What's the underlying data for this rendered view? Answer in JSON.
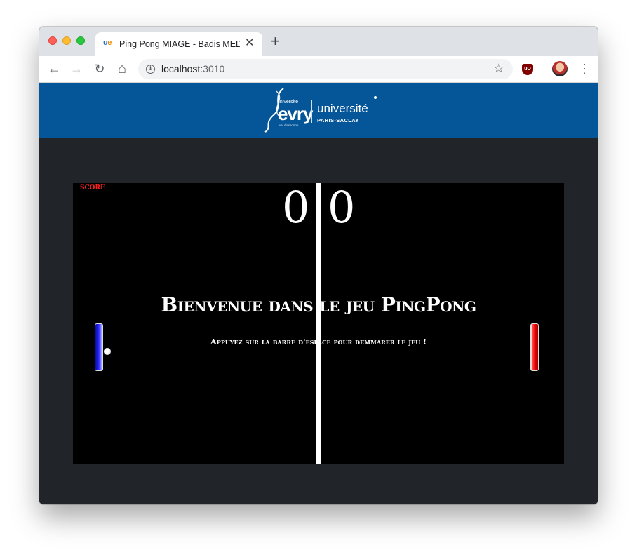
{
  "browser": {
    "tab": {
      "favicon_u": "u",
      "favicon_e": "e",
      "title": "Ping Pong MIAGE - Badis MEDDOUR",
      "close": "✕"
    },
    "new_tab": "+",
    "nav": {
      "back": "←",
      "forward": "→",
      "reload": "↻",
      "home": "⌂"
    },
    "url_host": "localhost:",
    "url_port": "3010",
    "bookmark": "☆",
    "extension": "uO",
    "menu": "⋮"
  },
  "header": {
    "logo_evry_small": "université",
    "logo_evry": "evry",
    "logo_evry_sub": "val d'essonne",
    "logo_univ": "université",
    "logo_paris": "PARIS-SACLAY",
    "background": "#055699"
  },
  "game": {
    "score_label": "SCORE",
    "score_left": "0",
    "score_right": "0",
    "welcome": "Bienvenue dans le jeu PingPong",
    "instruction": "Appuyez sur la barre d'espace pour demmarer le jeu !",
    "left_paddle_color": "#2727ff",
    "right_paddle_color": "#ee0000"
  }
}
